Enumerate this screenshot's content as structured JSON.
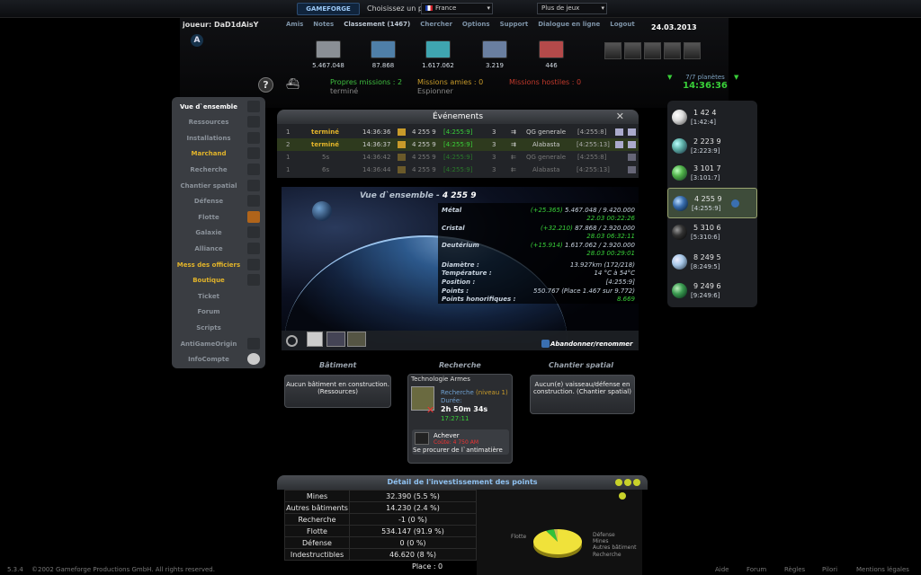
{
  "topbar": {
    "brand": "GAMEFORGE",
    "country_label": "Choisissez un pays:",
    "country_value": "France",
    "games_value": "Plus de jeux"
  },
  "header": {
    "player": "joueur: DaD1dAisY",
    "date": "24.03.2013",
    "nav": [
      "Amis",
      "Notes",
      "Classement (1467)",
      "Chercher",
      "Options",
      "Support",
      "Dialogue en ligne",
      "Logout"
    ],
    "resources": [
      {
        "name": "metal-icon",
        "value": "5.467.048",
        "color": "#8a8f95"
      },
      {
        "name": "crystal-icon",
        "value": "87.868",
        "color": "#4f7fa8"
      },
      {
        "name": "deuterium-icon",
        "value": "1.617.062",
        "color": "#3fa5b0"
      },
      {
        "name": "energy-icon",
        "value": "3.219",
        "color": "#6a7fa0"
      },
      {
        "name": "dark-matter-icon",
        "value": "446",
        "color": "#b44a4a"
      }
    ],
    "missions": {
      "own_label": "Propres missions : 2",
      "own_value": "terminé",
      "friendly_label": "Missions amies : 0",
      "friendly_value": "Espionner",
      "hostile_label": "Missions hostiles : 0"
    },
    "planets_count": "7/7 planètes",
    "clock": "14:36:36"
  },
  "menu": [
    "Vue d`ensemble",
    "Ressources",
    "Installations",
    "Marchand",
    "Recherche",
    "Chantier spatial",
    "Défense",
    "Flotte",
    "Galaxie",
    "Alliance",
    "Mess des officiers",
    "Boutique",
    "Ticket",
    "Forum",
    "Scripts",
    "AntiGameOrigin",
    "InfoCompte"
  ],
  "events": {
    "title": "Événements",
    "rows": [
      {
        "n": "1",
        "status": "terminé",
        "time": "14:36:36",
        "planet": "4 255 9",
        "coord": "[4:255:9]",
        "ships": "3",
        "dest": "QG generale",
        "dcoord": "[4:255:8]"
      },
      {
        "n": "2",
        "status": "terminé",
        "time": "14:36:37",
        "planet": "4 255 9",
        "coord": "[4:255:9]",
        "ships": "3",
        "dest": "Alabasta",
        "dcoord": "[4:255:13]"
      },
      {
        "n": "1",
        "status": "5s",
        "time": "14:36:42",
        "planet": "4 255 9",
        "coord": "[4:255:9]",
        "ships": "3",
        "dest": "QG generale",
        "dcoord": "[4:255:8]"
      },
      {
        "n": "1",
        "status": "6s",
        "time": "14:36:44",
        "planet": "4 255 9",
        "coord": "[4:255:9]",
        "ships": "3",
        "dest": "Alabasta",
        "dcoord": "[4:255:13]"
      }
    ]
  },
  "overview": {
    "title_prefix": "Vue d`ensemble -",
    "planet": "4 255 9",
    "abandon": "Abandonner/renommer",
    "metal_label": "Métal",
    "metal_rate": "(+25.365)",
    "metal_value": "5.467.048 / 9.420.000",
    "metal_date": "22.03 00:22:26",
    "crystal_label": "Cristal",
    "crystal_rate": "(+32.210)",
    "crystal_value": "87.868 / 2.920.000",
    "crystal_date": "28.03 06:32:11",
    "deut_label": "Deutérium",
    "deut_rate": "(+15.914)",
    "deut_value": "1.617.062 / 2.920.000",
    "deut_date": "28.03 00:29:01",
    "diameter_label": "Diamètre :",
    "diameter": "13.927km (172/218)",
    "temp_label": "Température :",
    "temp": "14 °C à 54°C",
    "position_label": "Position :",
    "position": "[4:255:9]",
    "points_label": "Points :",
    "points": "550.767 (Place 1.467 sur 9.772)",
    "honor_label": "Points honorifiques :",
    "honor": "8.669"
  },
  "sections": {
    "building": "Bâtiment",
    "research": "Recherche",
    "shipyard": "Chantier spatial",
    "building_text": "Aucun bâtiment en construction. (Ressources)",
    "shipyard_text": "Aucun(e) vaisseau/défense en construction. (Chantier spatial)",
    "research_title": "Technologie Armes",
    "research_sub": "Recherche",
    "research_level": "(niveau 1)",
    "duration_label": "Durée:",
    "duration": "2h 50m 34s",
    "end": "17:27:11",
    "complete": "Achever",
    "complete_cost": "Coûte: 4 750 AM",
    "complete_tail": "Se procurer de l`antimatière"
  },
  "detail": {
    "title": "Détail de l'investissement des points",
    "rows": [
      [
        "Mines",
        "32.390 (5.5 %)"
      ],
      [
        "Autres bâtiments",
        "14.230 (2.4 %)"
      ],
      [
        "Recherche",
        "-1 (0 %)"
      ],
      [
        "Flotte",
        "534.147 (91.9 %)"
      ],
      [
        "Défense",
        "0 (0 %)"
      ],
      [
        "Indestructibles",
        "46.620 (8 %)"
      ],
      [
        "",
        "Place : 0"
      ]
    ]
  },
  "chart_data": {
    "type": "pie",
    "categories": [
      "Flotte",
      "Défense",
      "Mines",
      "Autres bâtiment",
      "Recherche"
    ],
    "values": [
      91.9,
      0,
      5.5,
      2.4,
      0
    ],
    "colors": [
      "#f0e23a",
      "#3a6fd1",
      "#33c23a",
      "#d0c050",
      "#888"
    ]
  },
  "planets": [
    {
      "name": "1 42 4",
      "coord": "[1:42:4]",
      "color": "#dcdcdc"
    },
    {
      "name": "2 223 9",
      "coord": "[2:223:9]",
      "color": "#5fb0a8"
    },
    {
      "name": "3 101 7",
      "coord": "[3:101:7]",
      "color": "#4fb048"
    },
    {
      "name": "4 255 9",
      "coord": "[4:255:9]",
      "color": "#3a6fb0"
    },
    {
      "name": "5 310 6",
      "coord": "[5:310:6]",
      "color": "#333"
    },
    {
      "name": "8 249 5",
      "coord": "[8:249:5]",
      "color": "#a8c8e8"
    },
    {
      "name": "9 249 6",
      "coord": "[9:249:6]",
      "color": "#3a9a50"
    }
  ],
  "footer": {
    "version": "5.3.4",
    "copyright": "©2002 Gameforge Productions GmbH. All rights reserved.",
    "links": [
      "Aide",
      "Forum",
      "Règles",
      "Pilori",
      "Mentions légales"
    ]
  }
}
